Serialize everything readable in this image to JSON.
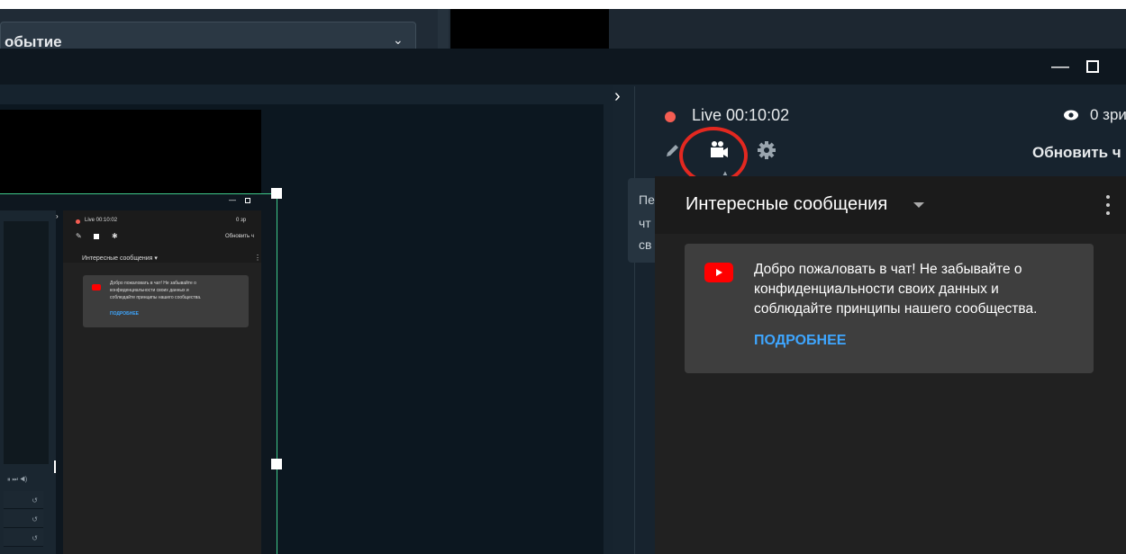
{
  "background": {
    "event_select_label": "обытие",
    "event_chevron": "⌄"
  },
  "window": {
    "minimize": "—"
  },
  "header": {
    "live_label": "Live 00:10:02",
    "viewers": "0 зри",
    "refresh_label": "Обновить ч"
  },
  "side_popup": {
    "lines": [
      "Пе",
      "чт",
      "св"
    ]
  },
  "chat": {
    "title": "Интересные сообщения",
    "welcome_text": "Добро пожаловать в чат! Не забывайте о конфиденциальности своих данных и соблюдайте принципы нашего сообщества.",
    "more_link": "ПОДРОБНЕЕ"
  },
  "mini": {
    "live_label": "Live 00:10:02",
    "viewers": "0 зр",
    "refresh_label": "Обновить ч",
    "chat_title": "Интересные сообщения ▾",
    "welcome_line1": "Добро пожаловать в чат! Не забывайте о",
    "welcome_line2": "конфиденциальности своих данных и",
    "welcome_line3": "соблюдайте принципы нашего сообщества.",
    "more_link": "ПОДРОБНЕЕ",
    "controls": "⏸ ⏭ ◀)",
    "row_icon": "↺"
  },
  "colors": {
    "accent_link": "#3ea6ff",
    "live_dot": "#f55d52",
    "selection": "#3fc98a",
    "annotation": "#e32820",
    "youtube": "#ff0000"
  }
}
